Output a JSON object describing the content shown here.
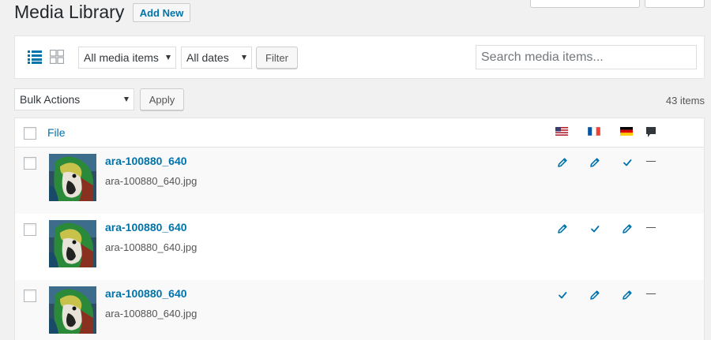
{
  "header": {
    "title": "Media Library",
    "add_new_label": "Add New"
  },
  "filters": {
    "media_type": "All media items",
    "dates": "All dates",
    "filter_button": "Filter",
    "search_placeholder": "Search media items..."
  },
  "bulk": {
    "action": "Bulk Actions",
    "apply_button": "Apply",
    "items_count": "43 items"
  },
  "table": {
    "column_file": "File",
    "language_columns": [
      {
        "flag": "us-flag-icon",
        "colors": [
          "#b22234",
          "#ffffff",
          "#3c3b6e"
        ]
      },
      {
        "flag": "france-flag-icon",
        "colors": [
          "#0055a4",
          "#ffffff",
          "#ef4135"
        ]
      },
      {
        "flag": "germany-flag-icon",
        "colors": [
          "#000000",
          "#dd0000",
          "#ffce00"
        ]
      }
    ],
    "comments_icon": "comment-icon",
    "rows": [
      {
        "title": "ara-100880_640",
        "filename": "ara-100880_640.jpg",
        "statuses": [
          "pencil-icon",
          "pencil-icon",
          "check-icon"
        ],
        "comments": "—"
      },
      {
        "title": "ara-100880_640",
        "filename": "ara-100880_640.jpg",
        "statuses": [
          "pencil-icon",
          "check-icon",
          "pencil-icon"
        ],
        "comments": "—"
      },
      {
        "title": "ara-100880_640",
        "filename": "ara-100880_640.jpg",
        "statuses": [
          "check-icon",
          "pencil-icon",
          "pencil-icon"
        ],
        "comments": "—"
      }
    ]
  },
  "colors": {
    "link": "#0073aa",
    "active_view": "#0073aa",
    "inactive_view": "#a0a5aa"
  }
}
